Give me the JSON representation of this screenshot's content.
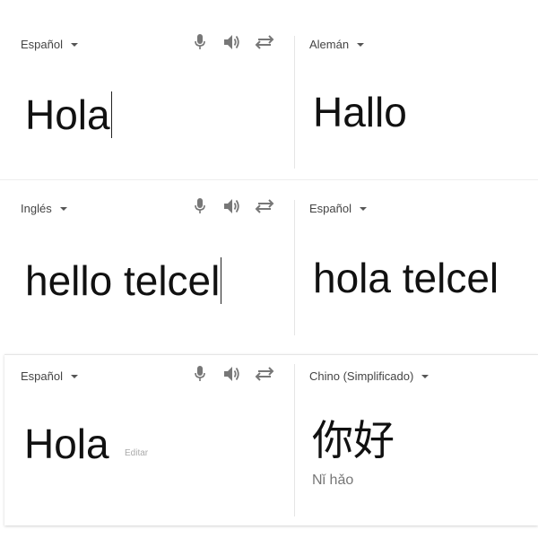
{
  "colors": {
    "icon": "#777777",
    "text": "#111111",
    "lang_label": "#444444",
    "muted": "#aaaaaa"
  },
  "panels": [
    {
      "source_language": "Español",
      "target_language": "Alemán",
      "source_text": "Hola",
      "target_text": "Hallo",
      "icons": [
        "microphone-icon",
        "speaker-icon",
        "swap-languages-icon"
      ]
    },
    {
      "source_language": "Inglés",
      "target_language": "Español",
      "source_text": "hello telcel",
      "target_text": "hola telcel",
      "icons": [
        "microphone-icon",
        "speaker-icon",
        "swap-languages-icon"
      ]
    },
    {
      "source_language": "Español",
      "target_language": "Chino (Simplificado)",
      "source_text": "Hola",
      "target_text": "你好",
      "edit_label": "Editar",
      "romanization": "Nǐ hǎo",
      "icons": [
        "microphone-icon",
        "speaker-icon",
        "swap-languages-icon"
      ]
    }
  ]
}
